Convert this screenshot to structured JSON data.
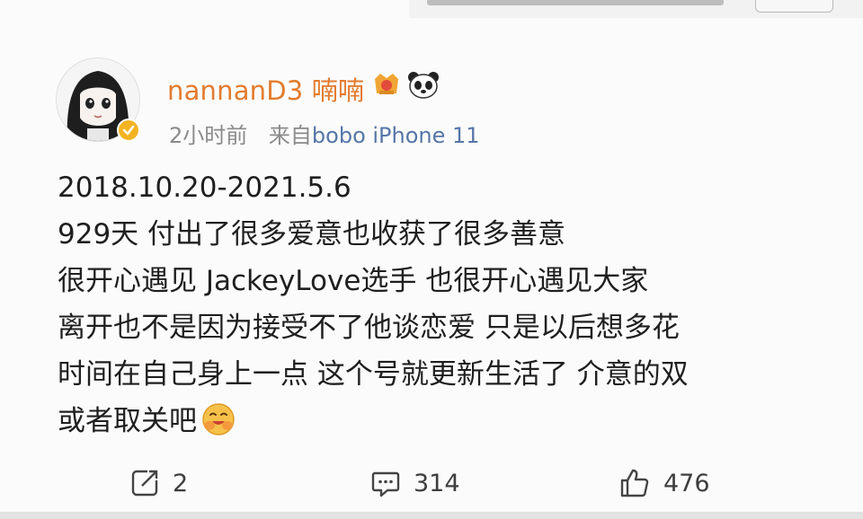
{
  "post": {
    "author": "nannanD3 喃喃",
    "time": "2小时前",
    "source_prefix": "来自",
    "device": "bobo iPhone 11",
    "lines": [
      "2018.10.20-2021.5.6",
      "929天 付出了很多爱意也收获了很多善意",
      "很开心遇见 JackeyLove选手 也很开心遇见大家",
      "离开也不是因为接受不了他谈恋爱 只是以后想多花",
      "时间在自己身上一点 这个号就更新生活了 介意的双",
      "或者取关吧"
    ],
    "icons": {
      "avatar": "anime-girl-avatar",
      "verified": "verified-badge-icon",
      "level": "vip-level-icon",
      "panda": "panda-icon",
      "emoji": "hug-emoji-icon"
    },
    "colors": {
      "author": "#e37b2e",
      "device": "#5676a8",
      "meta": "#8a8a8a",
      "verified": "#f3b321"
    }
  },
  "actions": {
    "repost_count": "2",
    "comment_count": "314",
    "like_count": "476"
  }
}
